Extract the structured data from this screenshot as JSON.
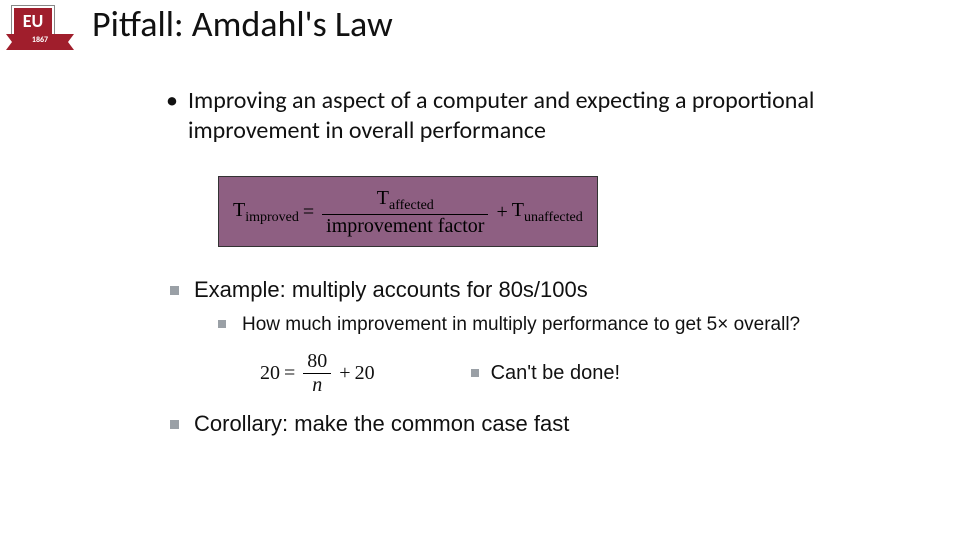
{
  "logo": {
    "text": "EU",
    "year": "1867"
  },
  "title": "Pitfall: Amdahl's Law",
  "bullet_top": "Improving an aspect of a computer and expecting a proportional improvement in overall performance",
  "formula1": {
    "lhs": "T",
    "lhs_sub": "improved",
    "eq": "=",
    "num": "T",
    "num_sub": "affected",
    "den": "improvement factor",
    "plus": "+",
    "tail": "T",
    "tail_sub": "unaffected"
  },
  "example": {
    "heading": "Example: multiply accounts for 80s/100s",
    "question": "How much improvement in multiply performance to get 5× overall?",
    "equation": {
      "lhs": "20",
      "eq": "=",
      "num": "80",
      "den": "n",
      "plus": "+",
      "tail": "20"
    },
    "result": "Can't be done!"
  },
  "corollary": "Corollary: make the common case fast"
}
